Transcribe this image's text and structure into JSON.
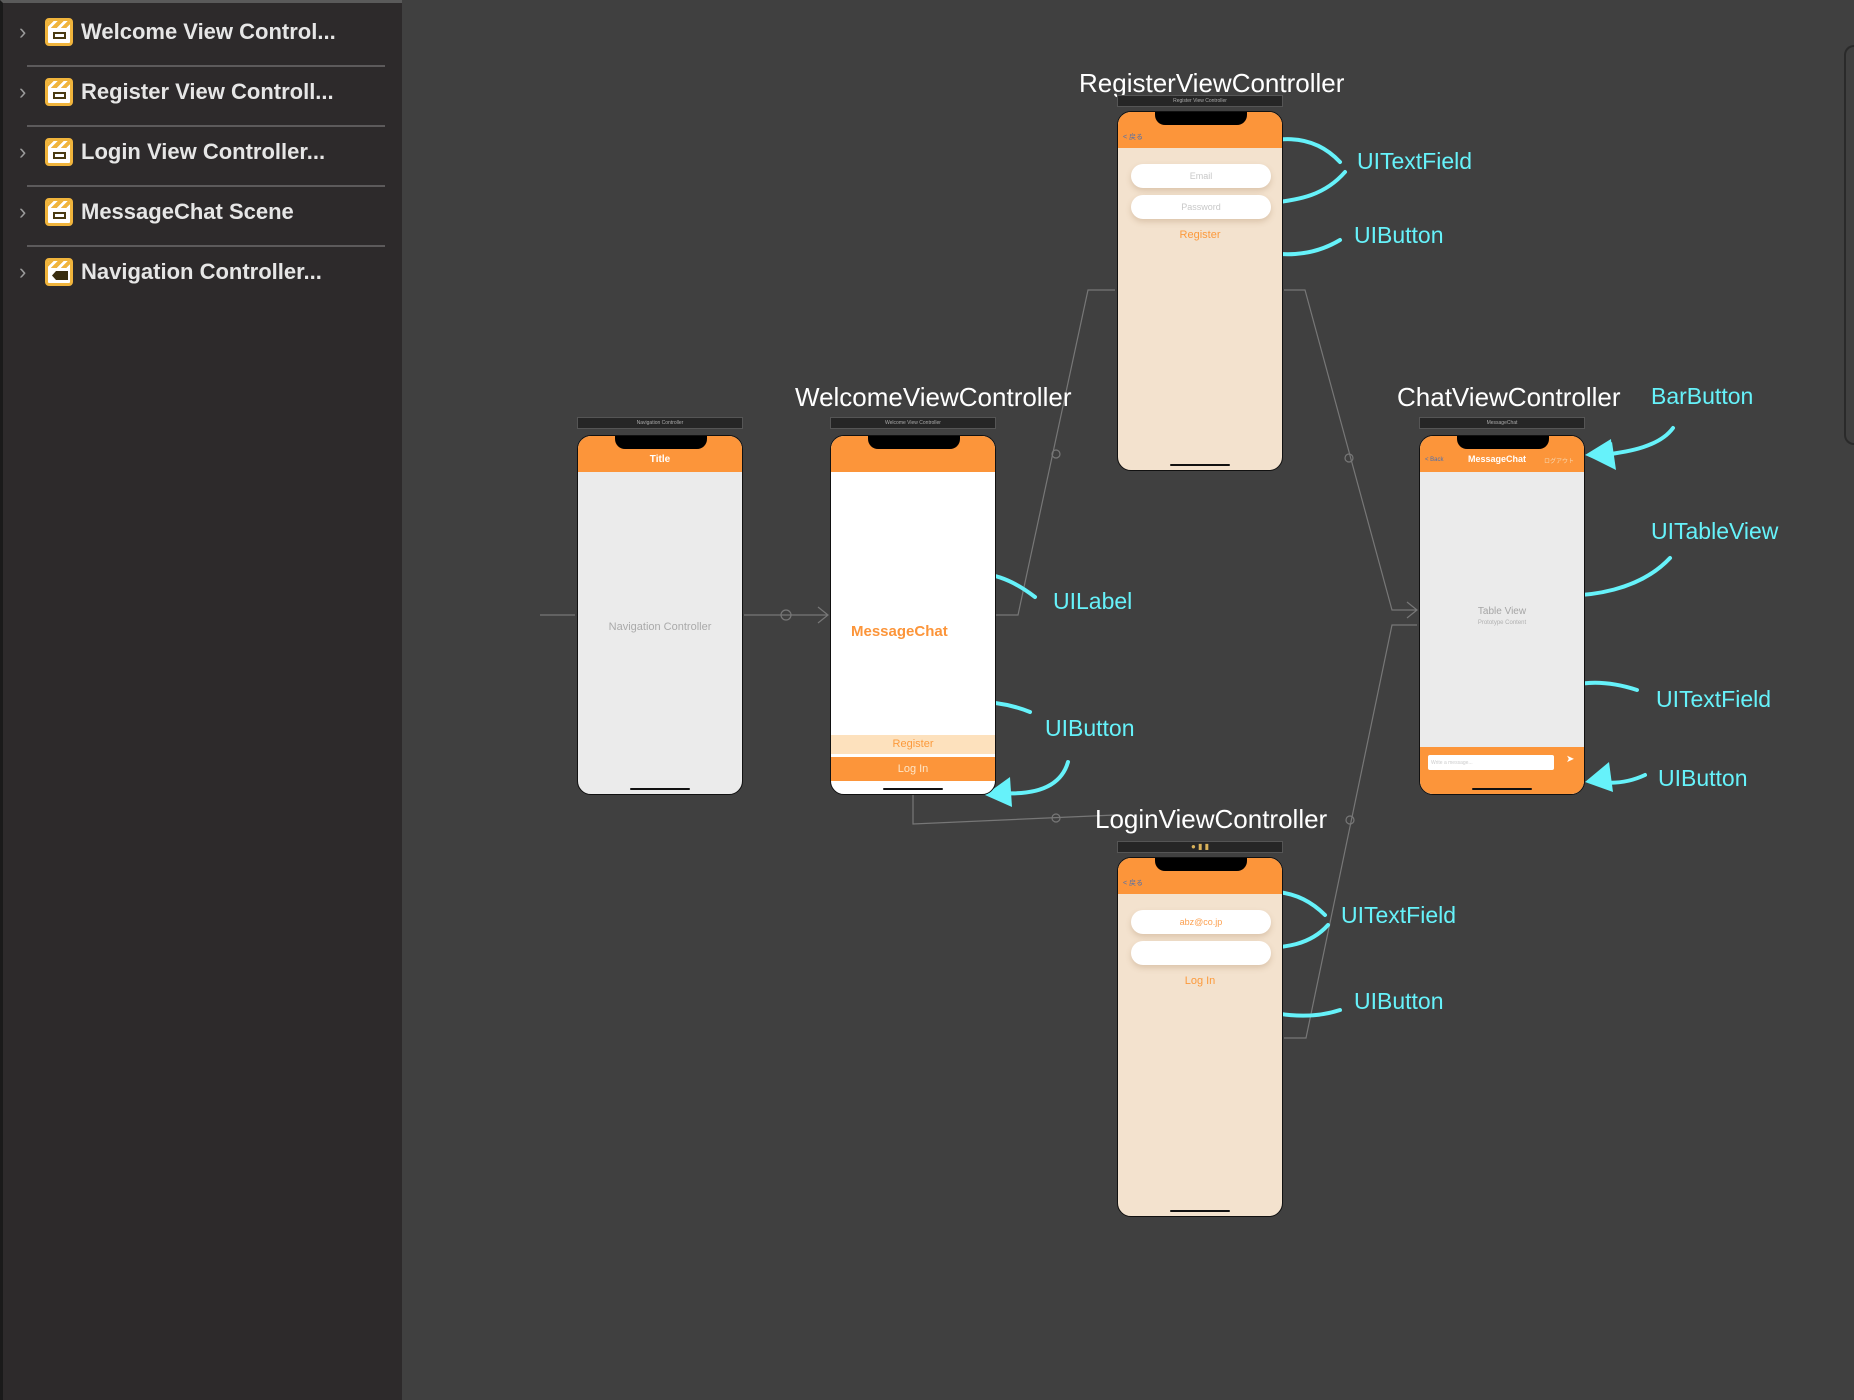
{
  "sidebar": {
    "items": [
      {
        "label": "Welcome View Control...",
        "icon": "view-controller-icon"
      },
      {
        "label": "Register View Controll...",
        "icon": "view-controller-icon"
      },
      {
        "label": "Login View Controller...",
        "icon": "view-controller-icon"
      },
      {
        "label": "MessageChat Scene",
        "icon": "view-controller-icon"
      },
      {
        "label": "Navigation Controller...",
        "icon": "navigation-controller-icon"
      }
    ]
  },
  "scenes": {
    "navigation": {
      "bar": "Navigation Controller",
      "nav_title": "Title",
      "body": "Navigation Controller"
    },
    "welcome": {
      "heading": "WelcomeViewController",
      "bar": "Welcome View Controller",
      "label": "MessageChat",
      "register": "Register",
      "login": "Log In"
    },
    "register": {
      "heading": "RegisterViewController",
      "bar": "Register View Controller",
      "back": "< 戻る",
      "email_placeholder": "Email",
      "password_placeholder": "Password",
      "button": "Register"
    },
    "login": {
      "heading": "LoginViewController",
      "back": "< 戻る",
      "email_value": "abz@co.jp",
      "button": "Log In"
    },
    "chat": {
      "heading": "ChatViewController",
      "bar": "MessageChat",
      "back": "< Back",
      "nav_title": "MessageChat",
      "bar_button": "ログアウト",
      "table_title": "Table View",
      "table_sub": "Prototype Content",
      "message_placeholder": "Write a message...",
      "send_icon": "paper-plane-icon"
    }
  },
  "annotations": {
    "register_textfield": "UITextField",
    "register_button": "UIButton",
    "welcome_label": "UILabel",
    "welcome_button": "UIButton",
    "chat_barbutton": "BarButton",
    "chat_tableview": "UITableView",
    "chat_textfield": "UITextField",
    "chat_button": "UIButton",
    "login_textfield": "UITextField",
    "login_button": "UIButton"
  },
  "colors": {
    "accent": "#fc953a",
    "annotation": "#66f2fa",
    "canvas": "#404040",
    "sidebar": "#2d2a2b",
    "form_bg": "#f3e2ce"
  }
}
